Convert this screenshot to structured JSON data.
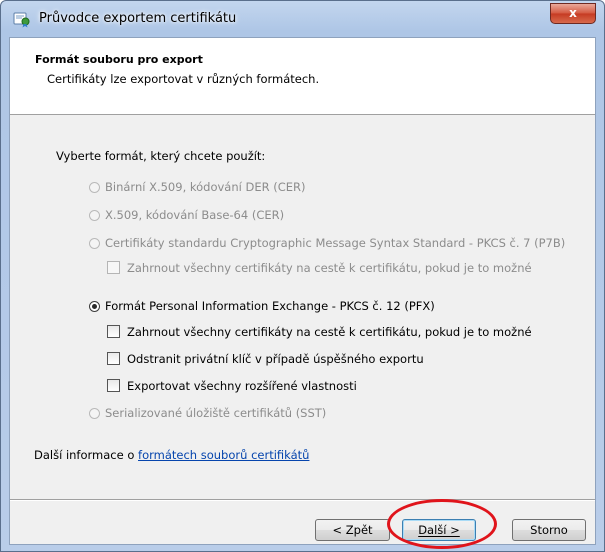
{
  "window": {
    "title": "Průvodce exportem certifikátu",
    "close_glyph": "x",
    "icon": "certificate-wizard-icon"
  },
  "header": {
    "title": "Formát souboru pro export",
    "subtitle": "Certifikáty lze exportovat v různých formátech."
  },
  "prompt": "Vyberte formát, který chcete použít:",
  "formats": {
    "der": {
      "label": "Binární X.509, kódování DER (CER)",
      "enabled": false,
      "selected": false
    },
    "base64": {
      "label": "X.509, kódování Base-64 (CER)",
      "enabled": false,
      "selected": false
    },
    "pkcs7": {
      "label": "Certifikáty standardu Cryptographic Message Syntax Standard - PKCS č. 7 (P7B)",
      "enabled": false,
      "selected": false,
      "include_chain": {
        "label": "Zahrnout všechny certifikáty na cestě k certifikátu, pokud je to možné",
        "enabled": false,
        "checked": false
      }
    },
    "pfx": {
      "label": "Formát Personal Information Exchange - PKCS č. 12 (PFX)",
      "enabled": true,
      "selected": true,
      "include_chain": {
        "label": "Zahrnout všechny certifikáty na cestě k certifikátu, pokud je to možné",
        "enabled": true,
        "checked": false
      },
      "delete_key": {
        "label": "Odstranit privátní klíč v případě úspěšného exportu",
        "enabled": true,
        "checked": false
      },
      "export_props": {
        "label": "Exportovat všechny rozšířené vlastnosti",
        "enabled": true,
        "checked": false
      }
    },
    "sst": {
      "label": "Serializované úložiště certifikátů (SST)",
      "enabled": false,
      "selected": false
    }
  },
  "info": {
    "prefix": "Další informace o ",
    "link": "formátech souborů certifikátů"
  },
  "buttons": {
    "back": "< Zpět",
    "next": "Další >",
    "cancel": "Storno"
  },
  "colors": {
    "annotation_ring": "#e0141b",
    "link": "#0645ad"
  }
}
